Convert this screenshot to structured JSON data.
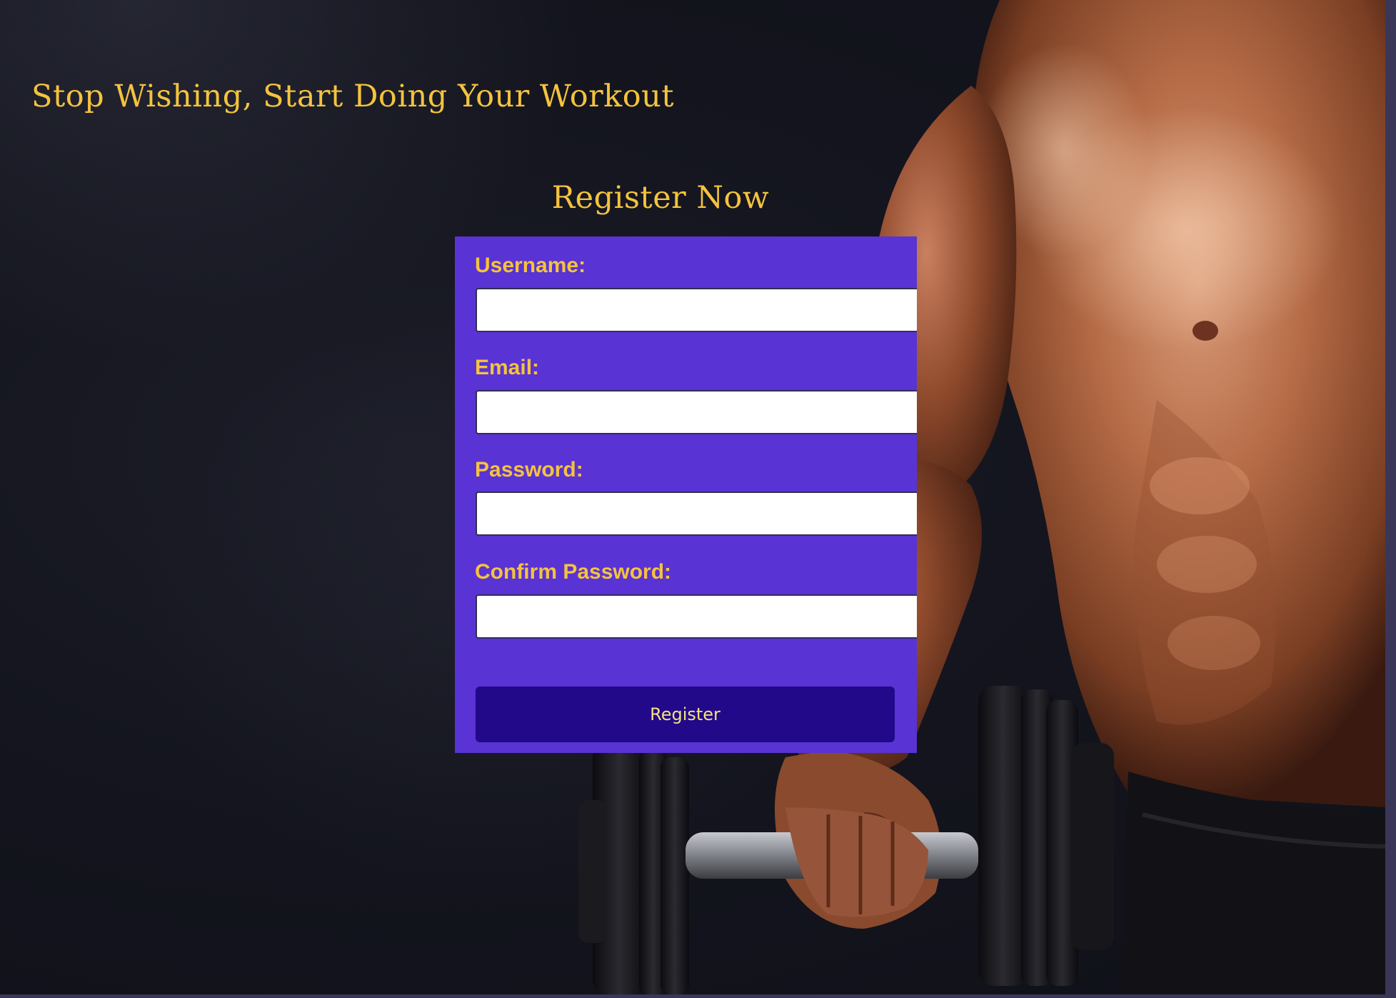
{
  "page": {
    "headline": "Stop Wishing, Start Doing Your Workout",
    "form_title": "Register Now"
  },
  "form": {
    "username_label": "Username:",
    "username_value": "",
    "email_label": "Email:",
    "email_value": "",
    "password_label": "Password:",
    "password_value": "",
    "confirm_password_label": "Confirm Password:",
    "confirm_password_value": "",
    "submit_label": "Register"
  },
  "colors": {
    "accent_gold": "#f4c33e",
    "card_purple": "#5933d3",
    "button_dark": "#21098a",
    "button_text": "#f6e27f"
  },
  "image": {
    "hero": "muscular-man-holding-dumbbell-photo"
  }
}
